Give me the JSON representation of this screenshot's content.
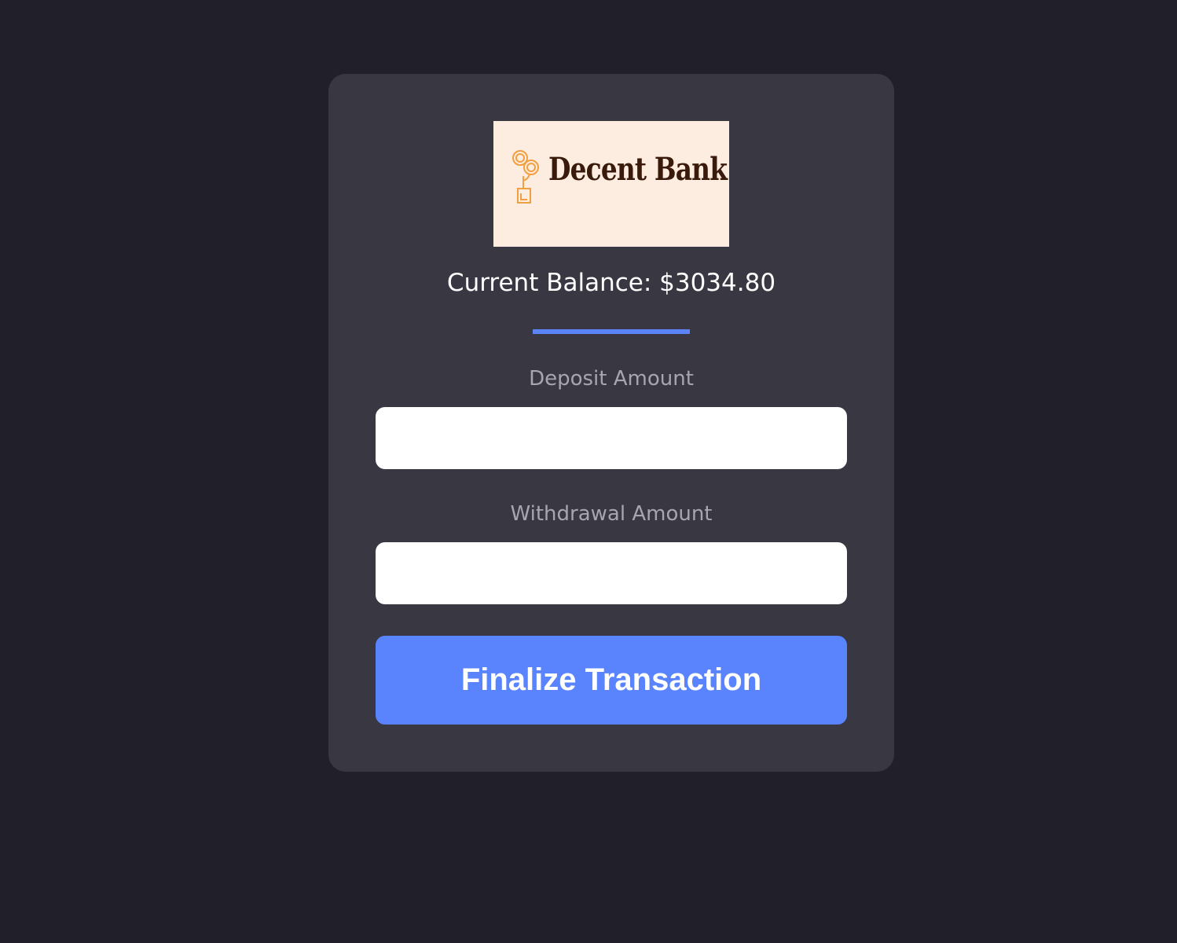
{
  "logo": {
    "text": "Decent Bank",
    "icon": "coin-plant-icon",
    "background_color": "#fdece0",
    "text_color": "#3a1a0a"
  },
  "balance": {
    "text": "Current Balance: $3034.80"
  },
  "deposit": {
    "label": "Deposit Amount",
    "value": ""
  },
  "withdrawal": {
    "label": "Withdrawal Amount",
    "value": ""
  },
  "submit": {
    "label": "Finalize Transaction"
  },
  "colors": {
    "page_background": "#211f2a",
    "card_background": "#393742",
    "accent": "#5a84fd",
    "label_text": "#a7a5ae"
  }
}
